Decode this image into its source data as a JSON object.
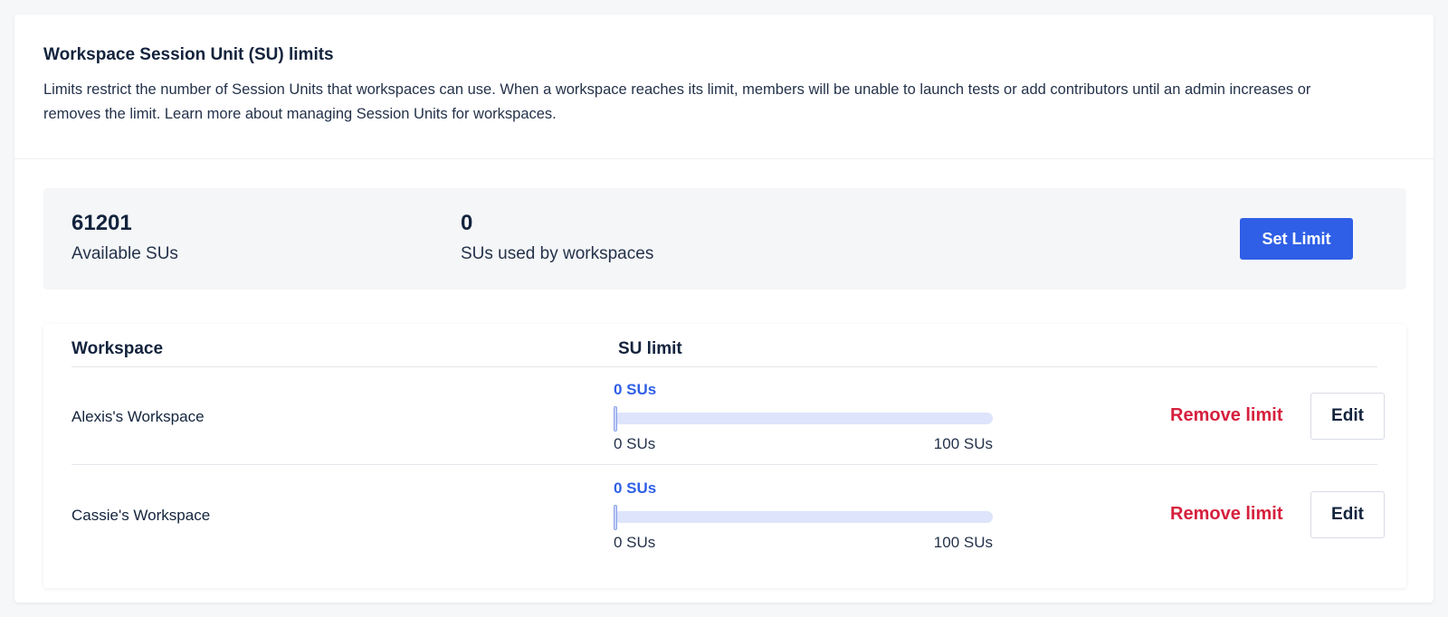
{
  "section": {
    "title": "Workspace Session Unit (SU) limits",
    "description": "Limits restrict the number of Session Units that workspaces can use. When a workspace reaches its limit, members will be unable to launch tests or add contributors until an admin increases or removes the limit. Learn more about managing Session Units for workspaces."
  },
  "summary": {
    "available_value": "61201",
    "available_label": "Available SUs",
    "used_value": "0",
    "used_label": "SUs used by workspaces",
    "set_limit_label": "Set Limit"
  },
  "table": {
    "headers": {
      "workspace": "Workspace",
      "su_limit": "SU limit"
    },
    "rows": [
      {
        "name": "Alexis's Workspace",
        "current_label": "0 SUs",
        "min_label": "0 SUs",
        "max_label": "100 SUs",
        "value": 0,
        "max": 100,
        "remove_label": "Remove limit",
        "edit_label": "Edit"
      },
      {
        "name": "Cassie's Workspace",
        "current_label": "0 SUs",
        "min_label": "0 SUs",
        "max_label": "100 SUs",
        "value": 0,
        "max": 100,
        "remove_label": "Remove limit",
        "edit_label": "Edit"
      }
    ]
  },
  "colors": {
    "primary": "#2f5fe6",
    "danger": "#d6203d",
    "text": "#13233d",
    "track": "#dde4fb"
  }
}
